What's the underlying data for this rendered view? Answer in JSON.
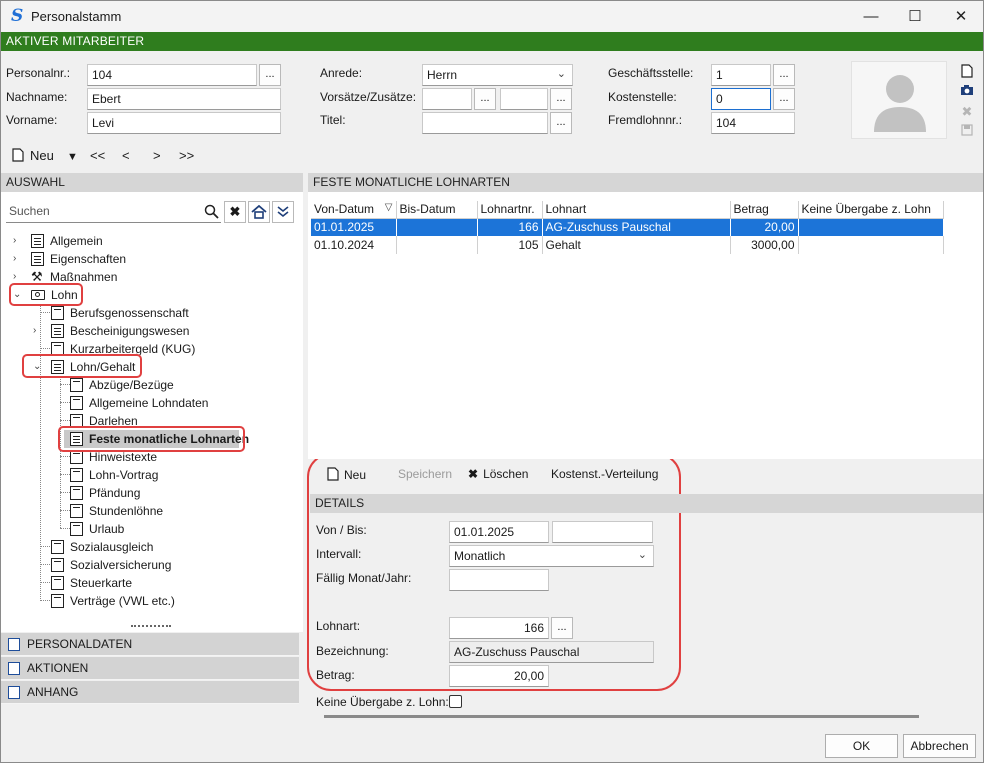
{
  "window": {
    "title": "Personalstamm",
    "header": "AKTIVER MITARBEITER"
  },
  "employee": {
    "personalnr_label": "Personalnr.:",
    "personalnr": "104",
    "nachname_label": "Nachname:",
    "nachname": "Ebert",
    "vorname_label": "Vorname:",
    "vorname": "Levi",
    "anrede_label": "Anrede:",
    "anrede": "Herrn",
    "vorsaetze_label": "Vorsätze/Zusätze:",
    "titel_label": "Titel:",
    "geschaeftsstelle_label": "Geschäftsstelle:",
    "geschaeftsstelle": "1",
    "kostenstelle_label": "Kostenstelle:",
    "kostenstelle": "0",
    "fremdlohnnr_label": "Fremdlohnnr.:",
    "fremdlohnnr": "104",
    "dots": "..."
  },
  "toolbar": {
    "new_label": "Neu",
    "first": "<<",
    "prev": "<",
    "next": ">",
    "last": ">>"
  },
  "left": {
    "header": "AUSWAHL",
    "search_placeholder": "Suchen",
    "tree": [
      {
        "label": "Allgemein"
      },
      {
        "label": "Eigenschaften"
      },
      {
        "label": "Maßnahmen"
      },
      {
        "label": "Lohn"
      },
      {
        "label": "Berufsgenossenschaft"
      },
      {
        "label": "Bescheinigungswesen"
      },
      {
        "label": "Kurzarbeitergeld (KUG)"
      },
      {
        "label": "Lohn/Gehalt"
      },
      {
        "label": "Abzüge/Bezüge"
      },
      {
        "label": "Allgemeine Lohndaten"
      },
      {
        "label": "Darlehen"
      },
      {
        "label": "Feste monatliche Lohnarten"
      },
      {
        "label": "Hinweistexte"
      },
      {
        "label": "Lohn-Vortrag"
      },
      {
        "label": "Pfändung"
      },
      {
        "label": "Stundenlöhne"
      },
      {
        "label": "Urlaub"
      },
      {
        "label": "Sozialausgleich"
      },
      {
        "label": "Sozialversicherung"
      },
      {
        "label": "Steuerkarte"
      },
      {
        "label": "Verträge (VWL etc.)"
      }
    ],
    "bottom_nav": [
      "PERSONALDATEN",
      "AKTIONEN",
      "ANHANG"
    ]
  },
  "right": {
    "header": "FESTE MONATLICHE LOHNARTEN",
    "columns": [
      "Von-Datum",
      "Bis-Datum",
      "Lohnartnr.",
      "Lohnart",
      "Betrag",
      "Keine Übergabe z. Lohn"
    ],
    "rows": [
      {
        "von": "01.01.2025",
        "bis": "",
        "nr": "166",
        "lohnart": "AG-Zuschuss Pauschal",
        "betrag": "20,00",
        "keine": ""
      },
      {
        "von": "01.10.2024",
        "bis": "",
        "nr": "105",
        "lohnart": "Gehalt",
        "betrag": "3000,00",
        "keine": ""
      }
    ]
  },
  "detail_toolbar": {
    "new": "Neu",
    "save": "Speichern",
    "delete": "Löschen",
    "cost": "Kostenst.-Verteilung"
  },
  "details": {
    "header": "DETAILS",
    "von_bis_label": "Von / Bis:",
    "von": "01.01.2025",
    "bis": "",
    "intervall_label": "Intervall:",
    "intervall": "Monatlich",
    "faellig_label": "Fällig Monat/Jahr:",
    "faellig": "",
    "lohnart_label": "Lohnart:",
    "lohnart": "166",
    "bezeichnung_label": "Bezeichnung:",
    "bezeichnung": "AG-Zuschuss Pauschal",
    "betrag_label": "Betrag:",
    "betrag": "20,00",
    "keine_label": "Keine Übergabe z. Lohn:"
  },
  "buttons": {
    "ok": "OK",
    "cancel": "Abbrechen"
  },
  "colors": {
    "header_green": "#2f7d1e",
    "selection_blue": "#1c74d8",
    "highlight_red": "#e04040"
  }
}
